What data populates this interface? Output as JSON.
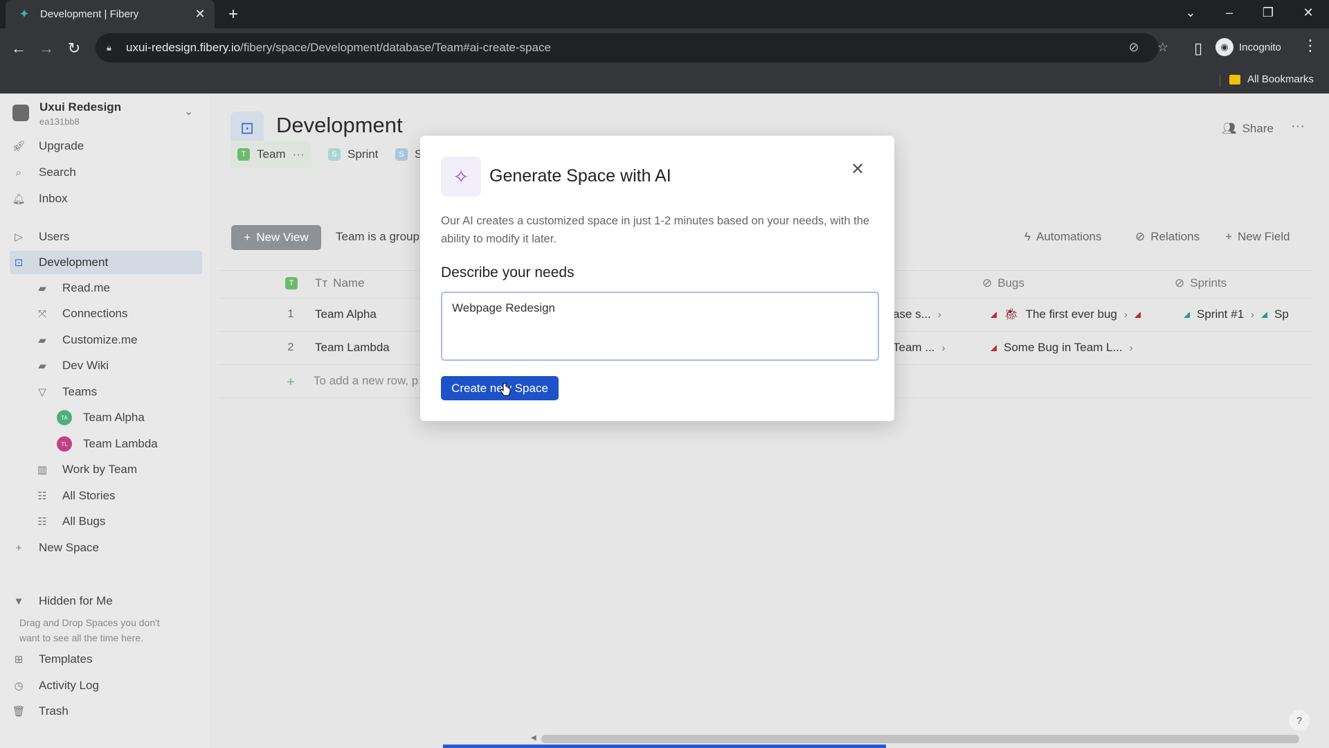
{
  "browser": {
    "tab_title": "Development | Fibery",
    "url_host": "uxui-redesign.fibery.io",
    "url_path": "/fibery/space/Development/database/Team#ai-create-space",
    "profile": "Incognito",
    "bookmarks_label": "All Bookmarks"
  },
  "workspace": {
    "name": "Uxui Redesign",
    "id": "ea131bb8"
  },
  "sidebar": {
    "top": [
      "Upgrade",
      "Search",
      "Inbox"
    ],
    "users": "Users",
    "development": "Development",
    "dev_items": [
      "Read.me",
      "Connections",
      "Customize.me",
      "Dev Wiki"
    ],
    "teams": "Teams",
    "team_items": [
      {
        "label": "Team Alpha",
        "badge": "TA",
        "color": "#4caf7d"
      },
      {
        "label": "Team Lambda",
        "badge": "TL",
        "color": "#c2407f"
      }
    ],
    "views": [
      "Work by Team",
      "All Stories",
      "All Bugs"
    ],
    "new_space": "New Space",
    "hidden_title": "Hidden for Me",
    "hidden_hint": "Drag and Drop Spaces you don't want to see all the time here.",
    "bottom": [
      "Templates",
      "Activity Log",
      "Trash"
    ]
  },
  "main": {
    "title": "Development",
    "share": "Share",
    "tabs": [
      {
        "label": "Team",
        "letter": "T",
        "color": "#6dba6d"
      },
      {
        "label": "Sprint",
        "letter": "S",
        "color": "#a9d6d0"
      },
      {
        "label": "S",
        "letter": "S",
        "color": "#a9c6e0"
      }
    ],
    "new_view": "New View",
    "description": "Team is a group",
    "toolbar": [
      "Automations",
      "Relations",
      "New Field"
    ],
    "columns": {
      "name": "Name",
      "bugs": "Bugs",
      "sprints": "Sprints"
    },
    "rows": [
      {
        "num": "1",
        "name": "Team Alpha",
        "frag": "ase s...",
        "bug": "The first ever bug",
        "sprint": "Sprint #1",
        "sprint_more": "Sp"
      },
      {
        "num": "2",
        "name": "Team Lambda",
        "frag": "Team ...",
        "bug": "Some Bug in Team L...",
        "sprint": "",
        "sprint_more": ""
      }
    ],
    "add_row": "To add a new row, p"
  },
  "dialog": {
    "title": "Generate Space with AI",
    "intro": "Our AI creates a customized space in just 1-2 minutes based on your needs, with the ability to modify it later.",
    "needs_label": "Describe your needs",
    "needs_value": "Webpage Redesign",
    "cta": "Create new Space"
  }
}
